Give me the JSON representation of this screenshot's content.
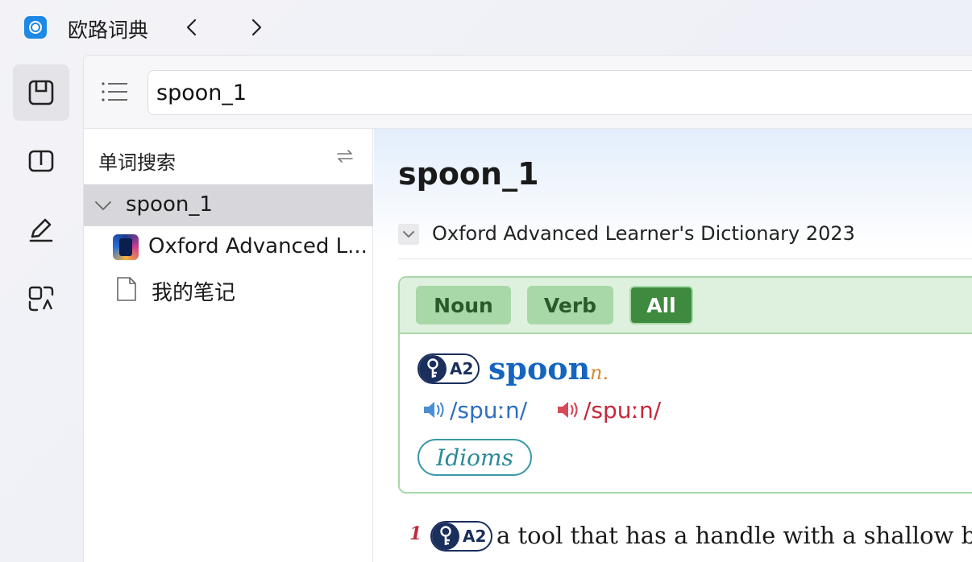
{
  "titlebar": {
    "app_title": "欧路词典",
    "app_icon": "eudic-logo-icon",
    "back_icon": "chevron-left-icon",
    "forward_icon": "chevron-right-icon"
  },
  "rail": {
    "items": [
      {
        "icon": "dictionary-icon",
        "active": true
      },
      {
        "icon": "book-icon",
        "active": false
      },
      {
        "icon": "pen-icon",
        "active": false
      },
      {
        "icon": "translate-icon",
        "active": false
      }
    ]
  },
  "search": {
    "value": "spoon_1",
    "menu_icon": "list-menu-icon"
  },
  "sidebar": {
    "title": "单词搜索",
    "swap_icon": "swap-icon",
    "tree": [
      {
        "label": "spoon_1",
        "expanded": true,
        "selected": true
      },
      {
        "label": "Oxford Advanced L...",
        "icon": "oxford-dictionary-icon"
      },
      {
        "label": "我的笔记",
        "icon": "document-icon"
      }
    ]
  },
  "content": {
    "headword": "spoon_1",
    "dictionary": "Oxford Advanced Learner's Dictionary 2023",
    "pos_tabs": [
      {
        "label": "Noun",
        "active": false
      },
      {
        "label": "Verb",
        "active": false
      },
      {
        "label": "All",
        "active": true
      }
    ],
    "entry": {
      "level": "A2",
      "word": "spoon",
      "pos": "n.",
      "pron_uk": "/spuːn/",
      "pron_us": "/spuːn/",
      "idioms_label": "Idioms"
    },
    "sense": {
      "number": "1",
      "level": "A2",
      "text": "a tool that has a handle with a shallow bowl at the end"
    }
  },
  "colors": {
    "accent_blue": "#1565c0",
    "green_border": "#a8d8a8",
    "green_active": "#3e8a3e",
    "badge_navy": "#1a2f5c",
    "us_red": "#c4283a"
  }
}
